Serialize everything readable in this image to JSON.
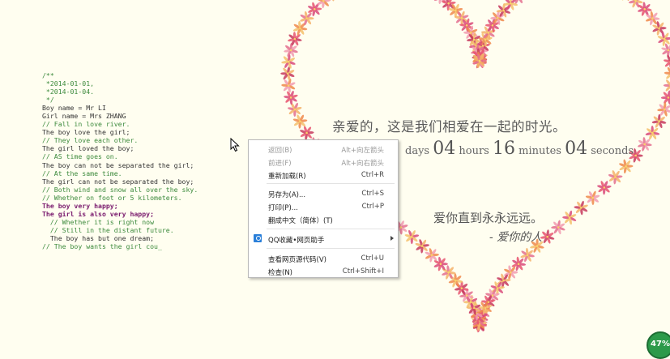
{
  "code_lines": [
    {
      "text": "/**",
      "cls": "c"
    },
    {
      "text": " *2014-01-01,",
      "cls": "c"
    },
    {
      "text": " *2014-01-04.",
      "cls": "c"
    },
    {
      "text": " */",
      "cls": "c"
    },
    {
      "text": "Boy name = Mr LI",
      "cls": ""
    },
    {
      "text": "Girl name = Mrs ZHANG",
      "cls": ""
    },
    {
      "text": "// Fall in love river.",
      "cls": "c"
    },
    {
      "text": "The boy love the girl;",
      "cls": ""
    },
    {
      "text": "// They love each other.",
      "cls": "c"
    },
    {
      "text": "The girl loved the boy;",
      "cls": ""
    },
    {
      "text": "// AS time goes on.",
      "cls": "c"
    },
    {
      "text": "The boy can not be separated the girl;",
      "cls": ""
    },
    {
      "text": "// At the same time.",
      "cls": "c"
    },
    {
      "text": "The girl can not be separated the boy;",
      "cls": ""
    },
    {
      "text": "// Both wind and snow all over the sky.",
      "cls": "c"
    },
    {
      "text": "// Whether on foot or 5 kilometers.",
      "cls": "c"
    },
    {
      "text": "The boy very happy;",
      "cls": "k"
    },
    {
      "text": "The girl is also very happy;",
      "cls": "k"
    },
    {
      "text": "  // Whether it is right now",
      "cls": "c"
    },
    {
      "text": "  // Still in the distant future.",
      "cls": "c"
    },
    {
      "text": "  The boy has but one dream;",
      "cls": ""
    },
    {
      "text": "// The boy wants the girl cou_",
      "cls": "c"
    }
  ],
  "headline": "亲爱的，这是我们相爱在一起的时光。",
  "timer": {
    "days_label": "days",
    "hours_value": "04",
    "hours_label": "hours",
    "minutes_value": "16",
    "minutes_label": "minutes",
    "seconds_value": "04",
    "seconds_label": "seconds"
  },
  "love_text": "爱你直到永永远远。",
  "signature": "- 爱你的人",
  "context_menu": {
    "items": [
      {
        "label": "返回(B)",
        "shortcut": "Alt+向左箭头",
        "disabled": true
      },
      {
        "label": "前进(F)",
        "shortcut": "Alt+向右箭头",
        "disabled": true
      },
      {
        "label": "重新加载(R)",
        "shortcut": "Ctrl+R",
        "disabled": false
      },
      {
        "label": "另存为(A)...",
        "shortcut": "Ctrl+S",
        "disabled": false
      },
      {
        "label": "打印(P)...",
        "shortcut": "Ctrl+P",
        "disabled": false
      },
      {
        "label": "翻成中文（简体）(T)",
        "shortcut": "",
        "disabled": false
      },
      {
        "label": "QQ收藏•网页助手",
        "shortcut": "",
        "disabled": false
      },
      {
        "label": "查看网页源代码(V)",
        "shortcut": "Ctrl+U",
        "disabled": false
      },
      {
        "label": "检查(N)",
        "shortcut": "Ctrl+Shift+I",
        "disabled": false
      }
    ]
  },
  "badge_percent": "47%",
  "colors": {
    "background": "#fffef0",
    "comment": "#3c8a3c",
    "keyword": "#7a1b6e",
    "petal_palette": [
      "#e8546f",
      "#f08a4b",
      "#f4b26a",
      "#d94a7a",
      "#f29bb0",
      "#c7385d",
      "#f5c06b",
      "#e46f8e"
    ]
  },
  "icons": [
    "cursor-arrow-icon",
    "qq-bookmark-icon",
    "submenu-arrow-icon",
    "heart-flower-decoration"
  ]
}
